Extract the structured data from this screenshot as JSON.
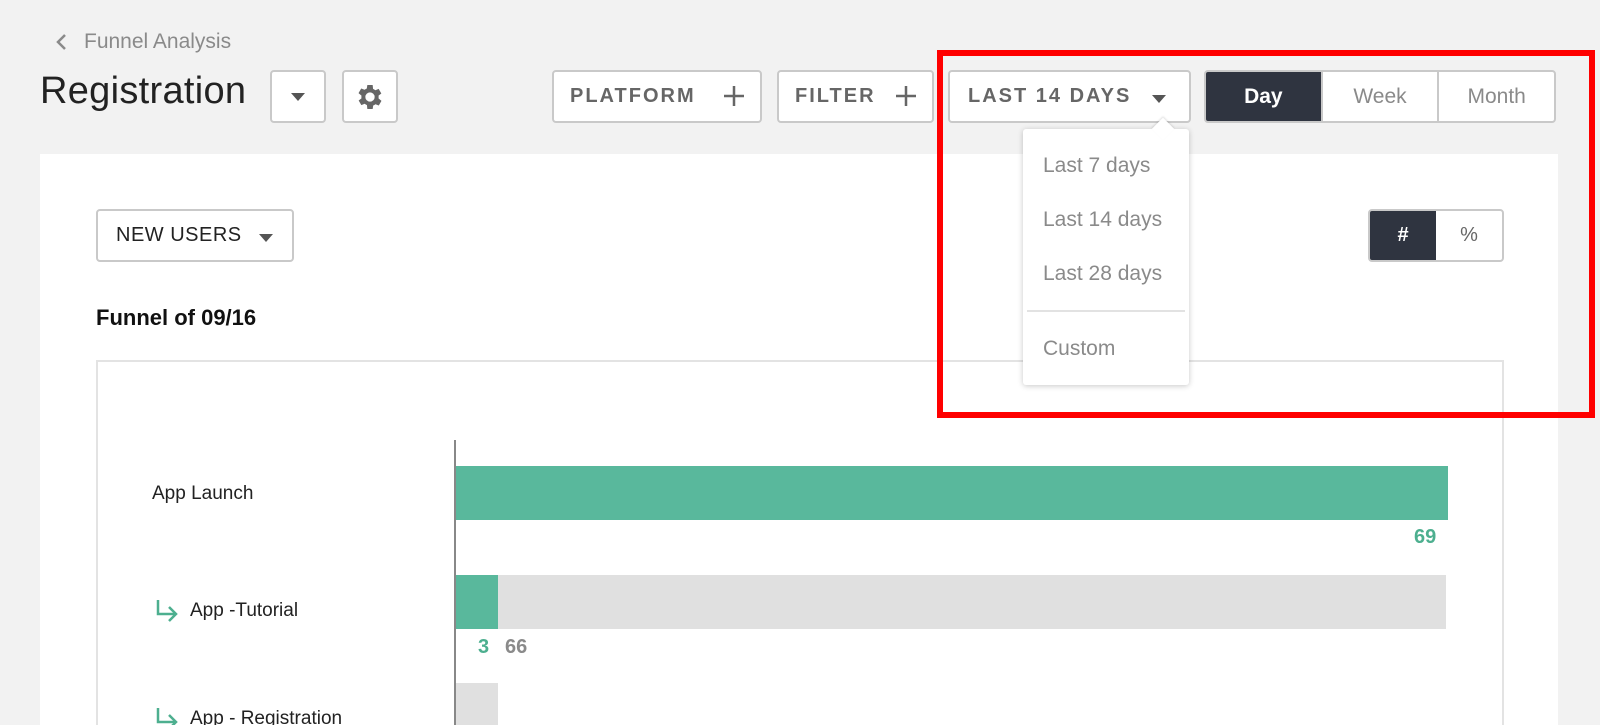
{
  "breadcrumb": {
    "back_icon": "chevron-left-icon",
    "label": "Funnel Analysis"
  },
  "header": {
    "title": "Registration",
    "dropdown_icon": "caret-down-icon",
    "settings_icon": "gear-icon",
    "platform_label": "PLATFORM",
    "filter_label": "FILTER",
    "date_range_label": "LAST 14 DAYS",
    "granularity": [
      "Day",
      "Week",
      "Month"
    ],
    "granularity_selected": "Day"
  },
  "date_menu": {
    "items": [
      "Last 7 days",
      "Last 14 days",
      "Last 28 days"
    ],
    "custom": "Custom"
  },
  "card": {
    "metric_label": "NEW USERS",
    "unit_options": [
      "#",
      "%"
    ],
    "unit_selected": "#",
    "funnel_title": "Funnel of 09/16"
  },
  "chart_data": {
    "type": "bar",
    "categories": [
      "App Launch",
      "App -Tutorial",
      "App - Registration"
    ],
    "converted": [
      69,
      3,
      0
    ],
    "dropped": [
      0,
      66,
      3
    ]
  },
  "colors": {
    "accent_green": "#59b89c",
    "active_dark": "#2f3440",
    "highlight_red": "#ff0000"
  }
}
